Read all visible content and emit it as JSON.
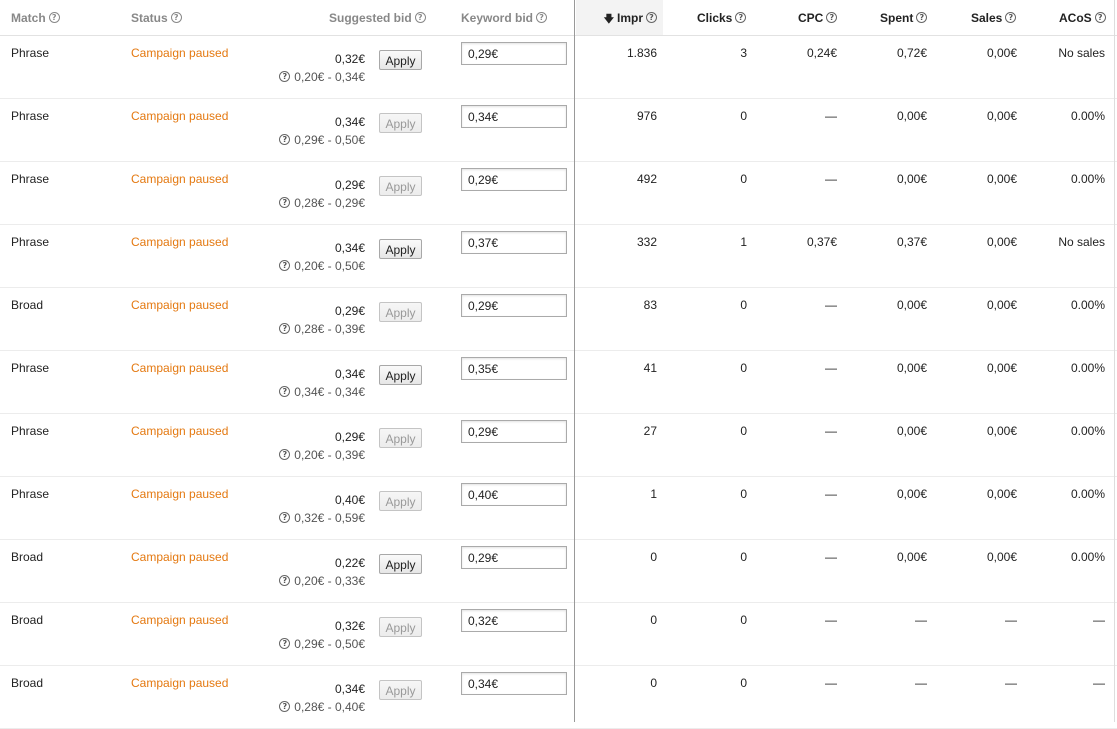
{
  "header": {
    "match": "Match",
    "status": "Status",
    "suggested_bid": "Suggested bid",
    "keyword_bid": "Keyword bid",
    "impr": "Impr",
    "clicks": "Clicks",
    "cpc": "CPC",
    "spent": "Spent",
    "sales": "Sales",
    "acos": "ACoS",
    "help_icon": "?"
  },
  "colors": {
    "status_paused": "#e47911",
    "divider": "#999999"
  },
  "apply_label": "Apply",
  "rows": [
    {
      "match": "Phrase",
      "status": "Campaign paused",
      "suggested": "0,32€",
      "range": "0,20€ - 0,34€",
      "apply_enabled": true,
      "bid": "0,29€",
      "impr": "1.836",
      "clicks": "3",
      "cpc": "0,24€",
      "spent": "0,72€",
      "sales": "0,00€",
      "acos": "No sales"
    },
    {
      "match": "Phrase",
      "status": "Campaign paused",
      "suggested": "0,34€",
      "range": "0,29€ - 0,50€",
      "apply_enabled": false,
      "bid": "0,34€",
      "impr": "976",
      "clicks": "0",
      "cpc": "—",
      "spent": "0,00€",
      "sales": "0,00€",
      "acos": "0.00%"
    },
    {
      "match": "Phrase",
      "status": "Campaign paused",
      "suggested": "0,29€",
      "range": "0,28€ - 0,29€",
      "apply_enabled": false,
      "bid": "0,29€",
      "impr": "492",
      "clicks": "0",
      "cpc": "—",
      "spent": "0,00€",
      "sales": "0,00€",
      "acos": "0.00%"
    },
    {
      "match": "Phrase",
      "status": "Campaign paused",
      "suggested": "0,34€",
      "range": "0,20€ - 0,50€",
      "apply_enabled": true,
      "bid": "0,37€",
      "impr": "332",
      "clicks": "1",
      "cpc": "0,37€",
      "spent": "0,37€",
      "sales": "0,00€",
      "acos": "No sales"
    },
    {
      "match": "Broad",
      "status": "Campaign paused",
      "suggested": "0,29€",
      "range": "0,28€ - 0,39€",
      "apply_enabled": false,
      "bid": "0,29€",
      "impr": "83",
      "clicks": "0",
      "cpc": "—",
      "spent": "0,00€",
      "sales": "0,00€",
      "acos": "0.00%"
    },
    {
      "match": "Phrase",
      "status": "Campaign paused",
      "suggested": "0,34€",
      "range": "0,34€ - 0,34€",
      "apply_enabled": true,
      "bid": "0,35€",
      "impr": "41",
      "clicks": "0",
      "cpc": "—",
      "spent": "0,00€",
      "sales": "0,00€",
      "acos": "0.00%"
    },
    {
      "match": "Phrase",
      "status": "Campaign paused",
      "suggested": "0,29€",
      "range": "0,20€ - 0,39€",
      "apply_enabled": false,
      "bid": "0,29€",
      "impr": "27",
      "clicks": "0",
      "cpc": "—",
      "spent": "0,00€",
      "sales": "0,00€",
      "acos": "0.00%"
    },
    {
      "match": "Phrase",
      "status": "Campaign paused",
      "suggested": "0,40€",
      "range": "0,32€ - 0,59€",
      "apply_enabled": false,
      "bid": "0,40€",
      "impr": "1",
      "clicks": "0",
      "cpc": "—",
      "spent": "0,00€",
      "sales": "0,00€",
      "acos": "0.00%"
    },
    {
      "match": "Broad",
      "status": "Campaign paused",
      "suggested": "0,22€",
      "range": "0,20€ - 0,33€",
      "apply_enabled": true,
      "bid": "0,29€",
      "impr": "0",
      "clicks": "0",
      "cpc": "—",
      "spent": "0,00€",
      "sales": "0,00€",
      "acos": "0.00%"
    },
    {
      "match": "Broad",
      "status": "Campaign paused",
      "suggested": "0,32€",
      "range": "0,29€ - 0,50€",
      "apply_enabled": false,
      "bid": "0,32€",
      "impr": "0",
      "clicks": "0",
      "cpc": "—",
      "spent": "—",
      "sales": "—",
      "acos": "—"
    },
    {
      "match": "Broad",
      "status": "Campaign paused",
      "suggested": "0,34€",
      "range": "0,28€ - 0,40€",
      "apply_enabled": false,
      "bid": "0,34€",
      "impr": "0",
      "clicks": "0",
      "cpc": "—",
      "spent": "—",
      "sales": "—",
      "acos": "—"
    }
  ]
}
